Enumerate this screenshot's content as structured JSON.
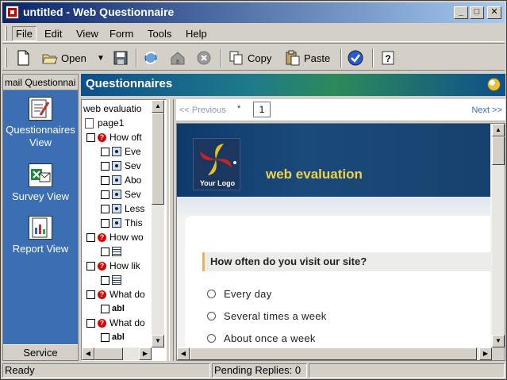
{
  "window": {
    "title": "untitled - Web Questionnaire",
    "controls": [
      "_",
      "□",
      "✕"
    ]
  },
  "menu": [
    "File",
    "Edit",
    "View",
    "Form",
    "Tools",
    "Help"
  ],
  "toolbar": {
    "open_label": "Open",
    "copy_label": "Copy",
    "paste_label": "Paste"
  },
  "leftnav": {
    "header": "mail Questionnai",
    "items": [
      {
        "label": "Questionnaires View",
        "icon": "questionnaire-icon"
      },
      {
        "label": "Survey View",
        "icon": "survey-icon"
      },
      {
        "label": "Report View",
        "icon": "report-icon"
      }
    ],
    "footer": "Service"
  },
  "header": {
    "title": "Questionnaires"
  },
  "tree": {
    "root": "web evaluatio",
    "page": "page1",
    "q1": "How oft",
    "q1_options": [
      "Eve",
      "Sev",
      "Abo",
      "Sev",
      "Less",
      "This"
    ],
    "q2": "How wo",
    "q3": "How lik",
    "q4": "What do",
    "q5": "What do",
    "abl": "abl"
  },
  "pagebar": {
    "previous": "<< Previous",
    "marker": "*",
    "current_page": "1",
    "next": "Next >>"
  },
  "preview": {
    "logo_caption": "Your Logo",
    "title": "web evaluation",
    "question": "How often do you visit our site?",
    "options": [
      "Every day",
      "Several times a week",
      "About once a week"
    ]
  },
  "status": {
    "left": "Ready",
    "middle": "Pending Replies: 0"
  },
  "colors": {
    "title_bar": "#0a246a",
    "nav_background": "#3c6eb4",
    "banner_title": "#f1d24a"
  }
}
